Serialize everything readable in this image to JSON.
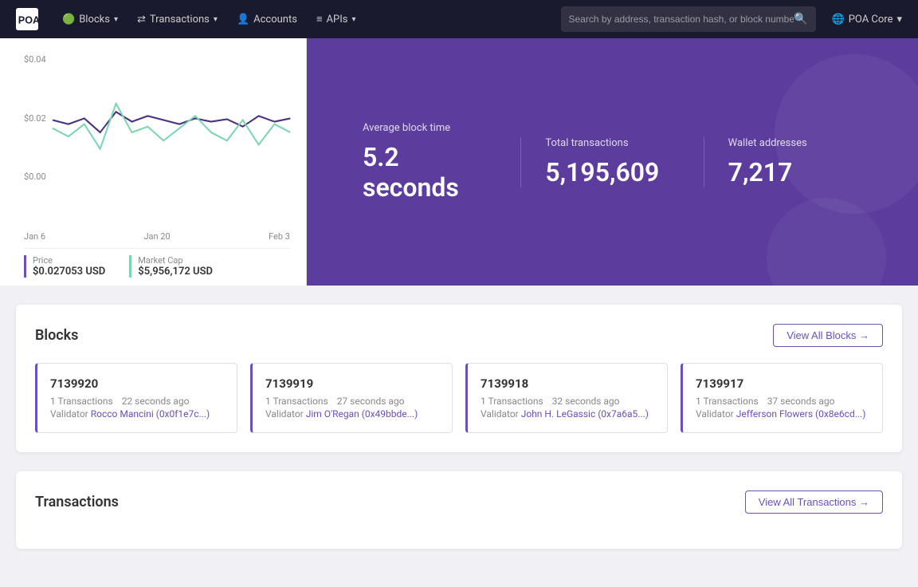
{
  "nav": {
    "logo_text": "POA",
    "items": [
      {
        "label": "Blocks",
        "has_dropdown": true
      },
      {
        "label": "Transactions",
        "has_dropdown": true
      },
      {
        "label": "Accounts",
        "has_dropdown": false
      },
      {
        "label": "APIs",
        "has_dropdown": true
      }
    ],
    "search_placeholder": "Search by address, transaction hash, or block number",
    "network_label": "POA Core"
  },
  "chart": {
    "y_labels": [
      "$0.04",
      "$0.02",
      "$0.00"
    ],
    "x_labels": [
      "Jan 6",
      "Jan 20",
      "Feb 3"
    ]
  },
  "price": {
    "price_label": "Price",
    "price_value": "$0.027053 USD",
    "market_cap_label": "Market Cap",
    "market_cap_value": "$5,956,172 USD"
  },
  "stats": [
    {
      "label": "Average block time",
      "value": "5.2 seconds"
    },
    {
      "label": "Total transactions",
      "value": "5,195,609"
    },
    {
      "label": "Wallet addresses",
      "value": "7,217"
    }
  ],
  "blocks": {
    "title": "Blocks",
    "view_all": "View All Blocks →",
    "items": [
      {
        "number": "7139920",
        "transactions": "1 Transactions",
        "time": "22 seconds ago",
        "validator_label": "Validator",
        "validator": "Rocco Mancini (0x0f1e7c...)"
      },
      {
        "number": "7139919",
        "transactions": "1 Transactions",
        "time": "27 seconds ago",
        "validator_label": "Validator",
        "validator": "Jim O'Regan (0x49bbde...)"
      },
      {
        "number": "7139918",
        "transactions": "1 Transactions",
        "time": "32 seconds ago",
        "validator_label": "Validator",
        "validator": "John H. LeGassic (0x7a6a5...)"
      },
      {
        "number": "7139917",
        "transactions": "1 Transactions",
        "time": "37 seconds ago",
        "validator_label": "Validator",
        "validator": "Jefferson Flowers (0x8e6cd...)"
      }
    ]
  },
  "transactions": {
    "title": "Transactions",
    "view_all": "View All Transactions →"
  }
}
